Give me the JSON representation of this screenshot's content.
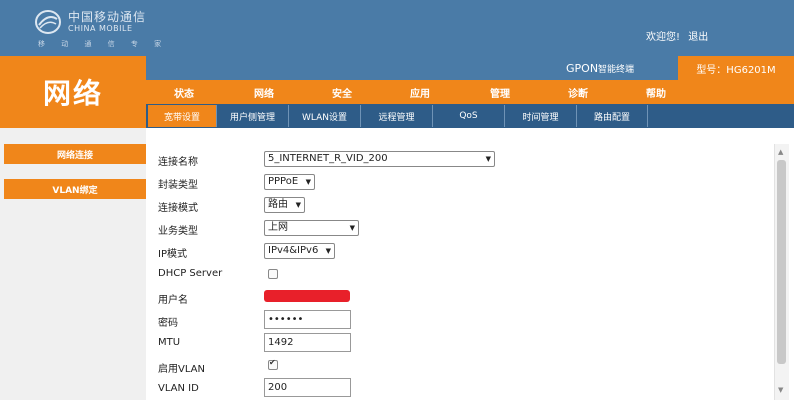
{
  "header": {
    "logo_cn": "中国移动通信",
    "logo_en": "CHINA MOBILE",
    "slogan": "移 动 通 信 专 家",
    "welcome_text": "欢迎您!",
    "exit_label": "退出"
  },
  "model_bar": {
    "product_prefix": "GPON",
    "product_suffix": "智能终端",
    "model_label": "型号：HG6201M"
  },
  "section_title": "网络",
  "main_nav": [
    {
      "label": "状态"
    },
    {
      "label": "网络",
      "active": true
    },
    {
      "label": "安全"
    },
    {
      "label": "应用"
    },
    {
      "label": "管理"
    },
    {
      "label": "诊断"
    },
    {
      "label": "帮助"
    }
  ],
  "sub_nav": [
    {
      "label": "宽带设置",
      "active": true
    },
    {
      "label": "用户侧管理"
    },
    {
      "label": "WLAN设置"
    },
    {
      "label": "远程管理"
    },
    {
      "label": "QoS"
    },
    {
      "label": "时间管理"
    },
    {
      "label": "路由配置"
    }
  ],
  "sidebar": [
    {
      "label": "网络连接",
      "active": true
    },
    {
      "label": "VLAN绑定"
    }
  ],
  "form": {
    "connection_name_label": "连接名称",
    "connection_name_value": "5_INTERNET_R_VID_200",
    "encap_label": "封装类型",
    "encap_value": "PPPoE",
    "mode_label": "连接模式",
    "mode_value": "路由",
    "service_label": "业务类型",
    "service_value": "上网",
    "ip_mode_label": "IP模式",
    "ip_mode_value": "IPv4&IPv6",
    "dhcp_label": "DHCP Server",
    "dhcp_checked": false,
    "username_label": "用户名",
    "password_label": "密码",
    "password_value": "••••••",
    "mtu_label": "MTU",
    "mtu_value": "1492",
    "vlan_enable_label": "启用VLAN",
    "vlan_enabled": true,
    "vlan_id_label": "VLAN ID",
    "vlan_id_value": "200"
  },
  "colors": {
    "header_blue": "#4a7ba7",
    "subnav_blue": "#2e5c88",
    "accent_orange": "#f0861a"
  },
  "icons": {
    "dropdown": "chevron-down-icon",
    "logo": "china-mobile-logo-icon"
  }
}
